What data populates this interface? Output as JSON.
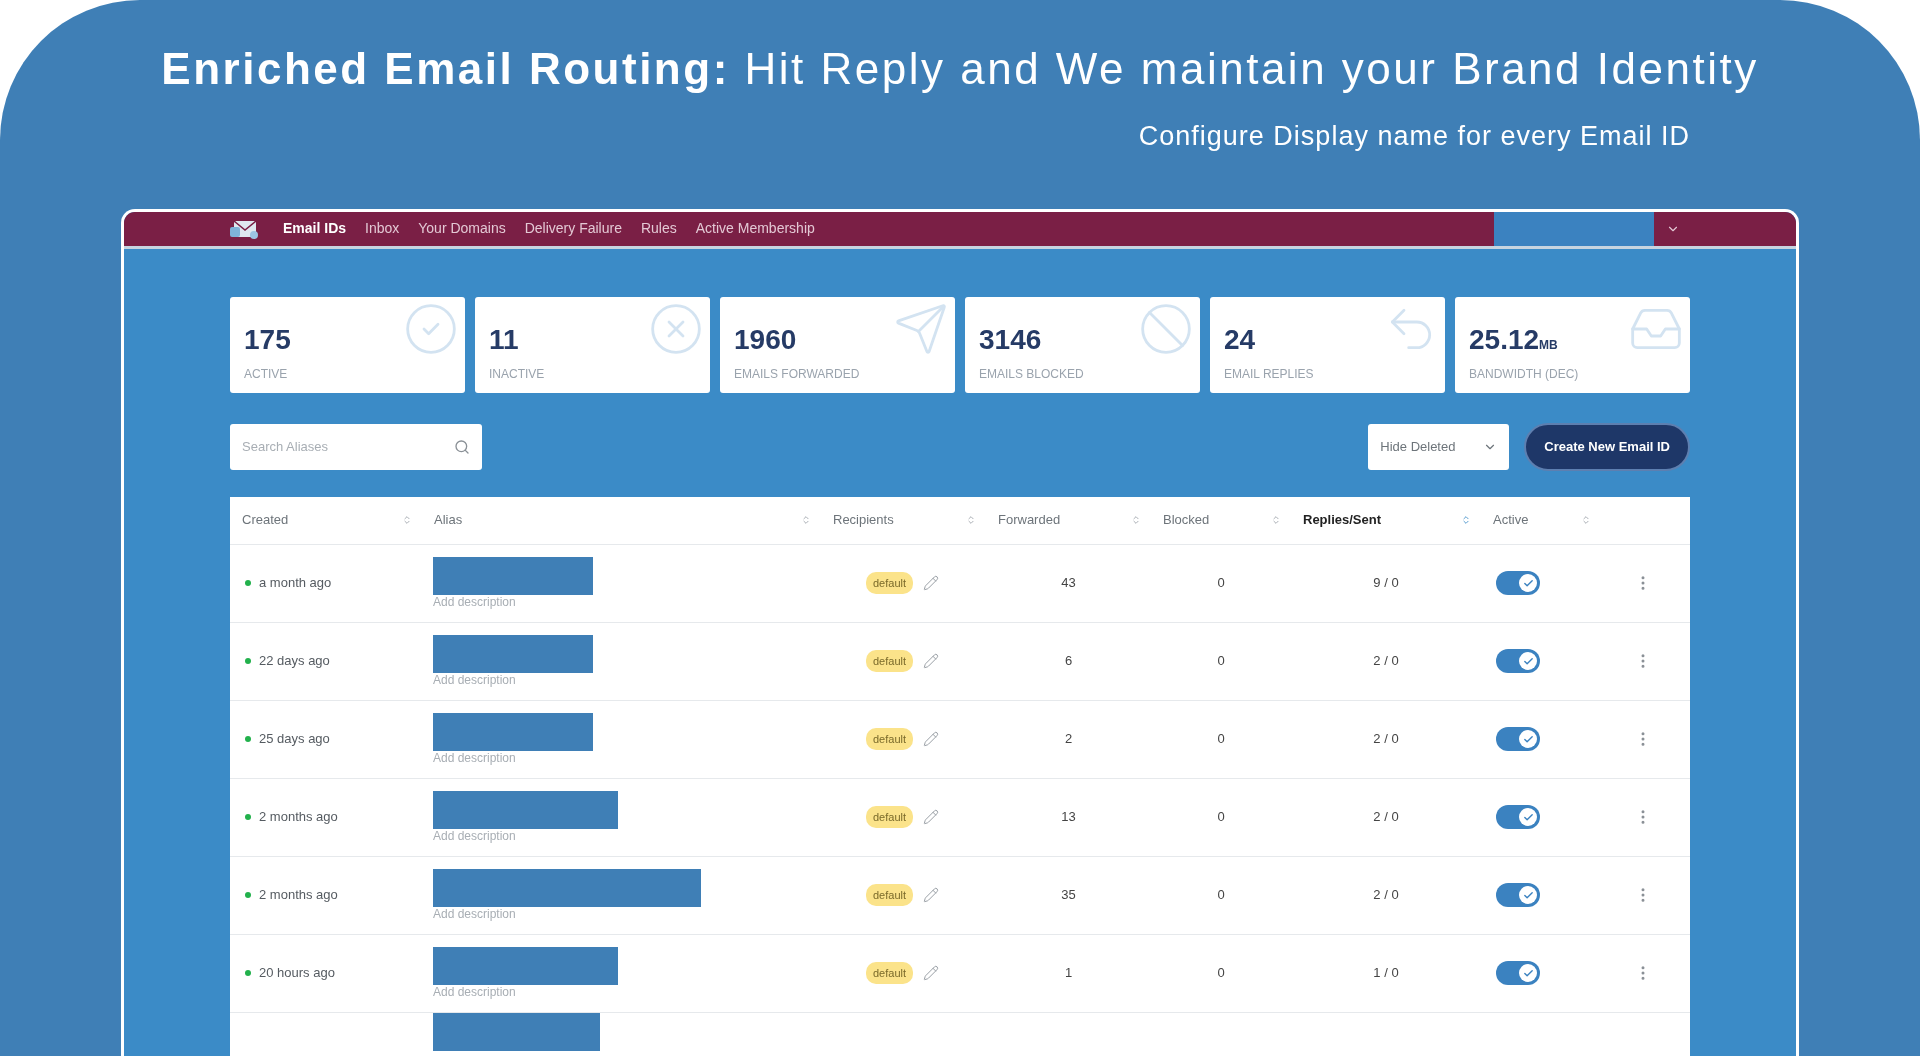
{
  "headline": {
    "title": "**Enriched Email Routing:** Hit Reply and We maintain your Brand Identity",
    "subtitle": "Configure Display name for every Email ID"
  },
  "nav": {
    "items": [
      {
        "label": "Email IDs",
        "selected": true
      },
      {
        "label": "Inbox",
        "selected": false
      },
      {
        "label": "Your Domains",
        "selected": false
      },
      {
        "label": "Delivery Failure",
        "selected": false
      },
      {
        "label": "Rules",
        "selected": false
      },
      {
        "label": "Active Membership",
        "selected": false
      }
    ]
  },
  "stats": [
    {
      "value": "175",
      "label": "ACTIVE"
    },
    {
      "value": "11",
      "label": "INACTIVE"
    },
    {
      "value": "1960",
      "label": "EMAILS FORWARDED"
    },
    {
      "value": "3146",
      "label": "EMAILS BLOCKED"
    },
    {
      "value": "24",
      "label": "EMAIL REPLIES"
    },
    {
      "value": "25.12",
      "unit": "MB",
      "label": "BANDWIDTH (DEC)"
    }
  ],
  "search": {
    "placeholder": "Search Aliases"
  },
  "filter": {
    "value": "Hide Deleted"
  },
  "create_button": "Create New Email ID",
  "table": {
    "columns": [
      {
        "label": "Created",
        "sorted": false
      },
      {
        "label": "Alias",
        "sorted": false
      },
      {
        "label": "Recipients",
        "sorted": false
      },
      {
        "label": "Forwarded",
        "sorted": false
      },
      {
        "label": "Blocked",
        "sorted": false
      },
      {
        "label": "Replies/Sent",
        "sorted": true
      },
      {
        "label": "Active",
        "sorted": false
      }
    ],
    "rows": [
      {
        "created": "a month ago",
        "description": "Add description",
        "recipient": "default",
        "forwarded": "43",
        "blocked": "0",
        "replies": "9 / 0",
        "active": true
      },
      {
        "created": "22 days ago",
        "description": "Add description",
        "recipient": "default",
        "forwarded": "6",
        "blocked": "0",
        "replies": "2 / 0",
        "active": true
      },
      {
        "created": "25 days ago",
        "description": "Add description",
        "recipient": "default",
        "forwarded": "2",
        "blocked": "0",
        "replies": "2 / 0",
        "active": true
      },
      {
        "created": "2 months ago",
        "description": "Add description",
        "recipient": "default",
        "forwarded": "13",
        "blocked": "0",
        "replies": "2 / 0",
        "active": true
      },
      {
        "created": "2 months ago",
        "description": "Add description",
        "recipient": "default",
        "forwarded": "35",
        "blocked": "0",
        "replies": "2 / 0",
        "active": true
      },
      {
        "created": "20 hours ago",
        "description": "Add description",
        "recipient": "default",
        "forwarded": "1",
        "blocked": "0",
        "replies": "1 / 0",
        "active": true
      }
    ]
  }
}
